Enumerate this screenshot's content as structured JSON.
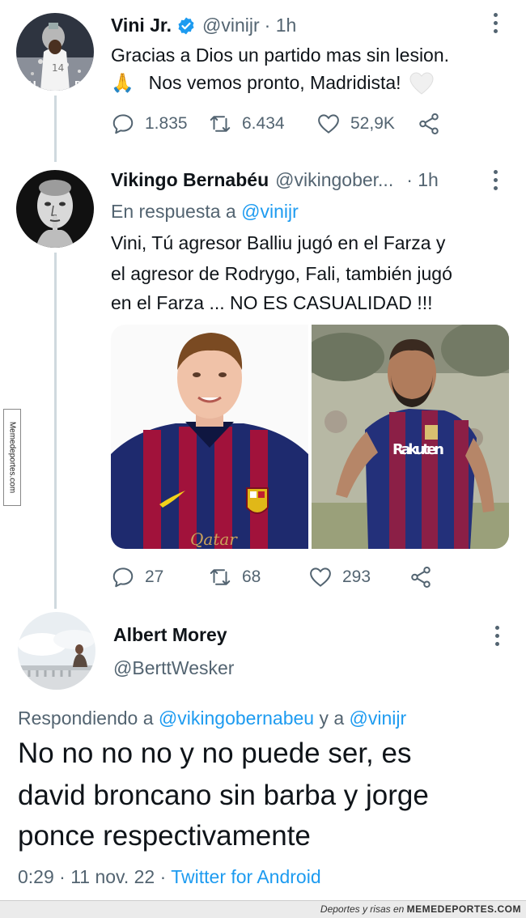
{
  "tweet1": {
    "name": "Vini Jr.",
    "handle": "@vinijr",
    "time": "· 1h",
    "text_line1": "Gracias a Dios un partido mas sin lesion.",
    "text_line2_emoji": "🙏",
    "text_line2": "Nos vemos pronto, Madridista!",
    "replies": "1.835",
    "retweets": "6.434",
    "likes": "52,9K"
  },
  "tweet2": {
    "name": "Vikingo Bernabéu",
    "handle": "@vikingober...",
    "time": "· 1h",
    "reply_prefix": "En respuesta a",
    "reply_mention": "@vinijr",
    "text_line1": "Vini, Tú agresor Balliu jugó en el Farza y",
    "text_line2": "el agresor de Rodrygo, Fali, también jugó",
    "text_line3": "en el Farza ...  NO ES CASUALIDAD !!!",
    "photo1_sponsor": "Qatar",
    "photo2_sponsor": "Rakuten",
    "replies": "27",
    "retweets": "68",
    "likes": "293"
  },
  "tweet3": {
    "name": "Albert Morey",
    "handle": "@BerttWesker",
    "reply_prefix": "Respondiendo a",
    "reply_mention1": "@vikingobernabeu",
    "reply_and": "y a",
    "reply_mention2": "@vinijr",
    "text_line1": "No no no no y no puede ser, es",
    "text_line2": "david broncano sin barba y jorge",
    "text_line3": "ponce respectivamente",
    "meta_time": "0:29 · 11 nov. 22 ·",
    "meta_client": "Twitter for Android"
  },
  "watermark": {
    "side": "Memedeportes.com",
    "footer_prefix": "Deportes y risas en",
    "footer_brand": "MEMEDEPORTES.COM"
  },
  "colors": {
    "link": "#1d9bf0",
    "secondary": "#536471",
    "verified": "#1d9bf0"
  }
}
